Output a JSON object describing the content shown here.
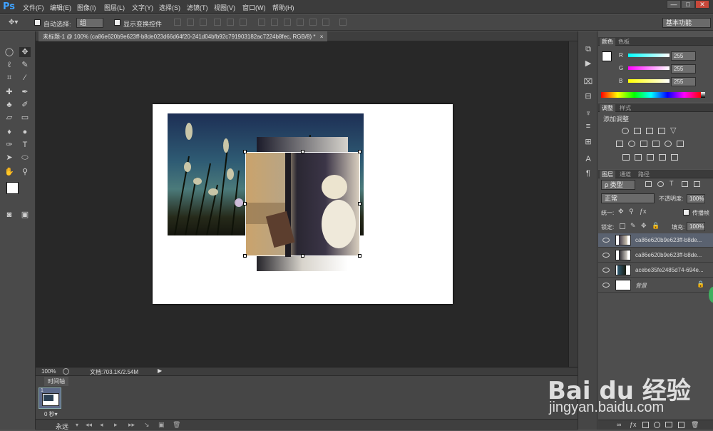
{
  "app": {
    "logo": "Ps"
  },
  "menu": [
    "文件(F)",
    "编辑(E)",
    "图像(I)",
    "图层(L)",
    "文字(Y)",
    "选择(S)",
    "滤镜(T)",
    "视图(V)",
    "窗口(W)",
    "帮助(H)"
  ],
  "window_controls": {
    "minimize": "—",
    "maximize": "□",
    "close": "✕"
  },
  "options": {
    "auto_select_label": "自动选择:",
    "auto_select_value": "组",
    "show_transform_label": "显示变换控件",
    "workspace": "基本功能"
  },
  "document": {
    "tab_title": "未标题-1 @ 100% (ca86e620b9e623ff-b8de023d66d64f20-241d04bfb92c791903182ac7224b8fec, RGB/8) *",
    "tab_close": "×"
  },
  "status": {
    "zoom": "100%",
    "doc_info": "文档:703.1K/2.54M"
  },
  "timeline": {
    "tab": "时间轴",
    "frame_number": "1",
    "frame_delay": "0 秒▾",
    "loop": "永远"
  },
  "color_panel": {
    "tabs": [
      "颜色",
      "色板"
    ],
    "r_label": "R",
    "g_label": "G",
    "b_label": "B",
    "r": "255",
    "g": "255",
    "b": "255"
  },
  "adjust_panel": {
    "tabs": [
      "调整",
      "样式"
    ],
    "title": "添加调整"
  },
  "layers_panel": {
    "tabs": [
      "图层",
      "通道",
      "路径"
    ],
    "kind": "ρ 类型",
    "blend": "正常",
    "opacity_label": "不透明度:",
    "opacity": "100%",
    "unify_label": "统一:",
    "propagate_label": "传播帧",
    "lock_label": "锁定:",
    "fill_label": "填充:",
    "fill": "100%",
    "layers": [
      {
        "name": "ca86e620b9e623ff-b8de..."
      },
      {
        "name": "ca86e620b9e623ff-b8de..."
      },
      {
        "name": "acebe35fe2485d74-694e..."
      },
      {
        "name": "背景"
      }
    ]
  },
  "watermark": {
    "brand": "Bai du 经验",
    "url": "jingyan.baidu.com"
  },
  "colors": {
    "accent": "#3fa2ff",
    "bg": "#535353",
    "canvas_bg": "#282828"
  }
}
